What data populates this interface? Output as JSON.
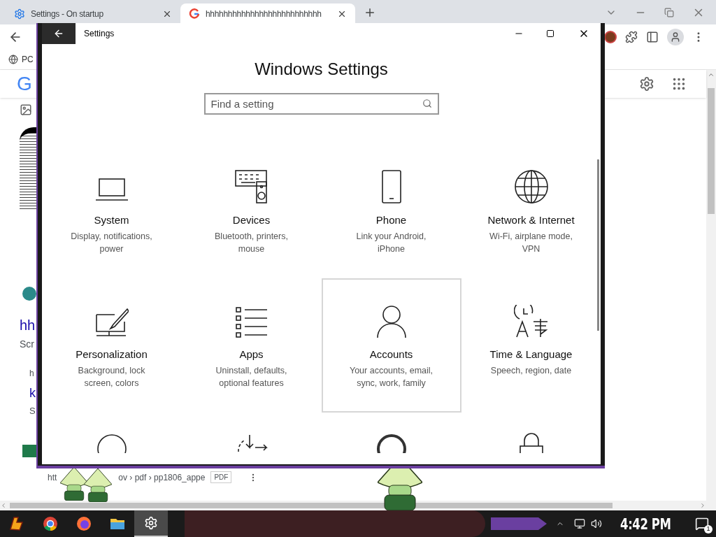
{
  "browser": {
    "tabs": [
      {
        "title": "Settings - On startup",
        "selected": false,
        "kind": "settings"
      },
      {
        "title": "hhhhhhhhhhhhhhhhhhhhhhhhhh",
        "selected": true,
        "kind": "google"
      }
    ],
    "bookmark": "PC",
    "logo_letter": "G",
    "page_fragments": [
      "hh",
      "Scr",
      "h",
      "k",
      "S"
    ],
    "result": {
      "url_start": "htt",
      "path": "ov › pdf › pp1806_appe",
      "badge": "PDF"
    }
  },
  "settings_window": {
    "title": "Settings",
    "heading": "Windows Settings",
    "search": {
      "placeholder": "Find a setting"
    },
    "tiles": [
      {
        "title": "System",
        "description": "Display, notifications, power",
        "hovered": false
      },
      {
        "title": "Devices",
        "description": "Bluetooth, printers, mouse",
        "hovered": false
      },
      {
        "title": "Phone",
        "description": "Link your Android, iPhone",
        "hovered": false
      },
      {
        "title": "Network & Internet",
        "description": "Wi-Fi, airplane mode, VPN",
        "hovered": false
      },
      {
        "title": "Personalization",
        "description": "Background, lock screen, colors",
        "hovered": false
      },
      {
        "title": "Apps",
        "description": "Uninstall, defaults, optional features",
        "hovered": false
      },
      {
        "title": "Accounts",
        "description": "Your accounts, email, sync, work, family",
        "hovered": true
      },
      {
        "title": "Time & Language",
        "description": "Speech, region, date",
        "hovered": false
      }
    ]
  },
  "taskbar": {
    "apps": [
      {
        "kind": "start",
        "selected": false
      },
      {
        "kind": "chrome",
        "selected": false
      },
      {
        "kind": "firefox",
        "selected": false
      },
      {
        "kind": "files",
        "selected": false
      },
      {
        "kind": "settings",
        "selected": true
      }
    ],
    "clock": "4:42 PM",
    "notifications": "1"
  }
}
